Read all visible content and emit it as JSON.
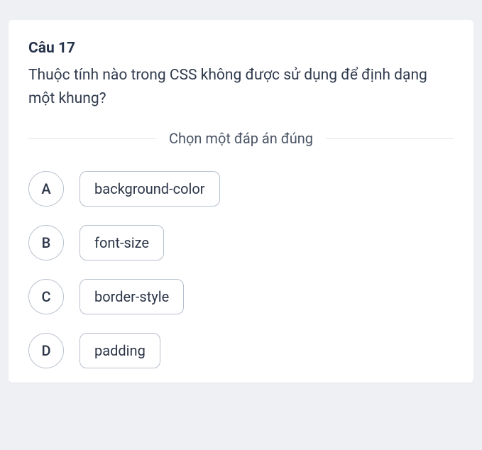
{
  "question": {
    "number": "Câu 17",
    "text": "Thuộc tính nào trong CSS không được sử dụng để định dạng một khung?",
    "instruction": "Chọn một đáp án đúng",
    "options": [
      {
        "letter": "A",
        "text": "background-color"
      },
      {
        "letter": "B",
        "text": "font-size"
      },
      {
        "letter": "C",
        "text": "border-style"
      },
      {
        "letter": "D",
        "text": "padding"
      }
    ]
  }
}
